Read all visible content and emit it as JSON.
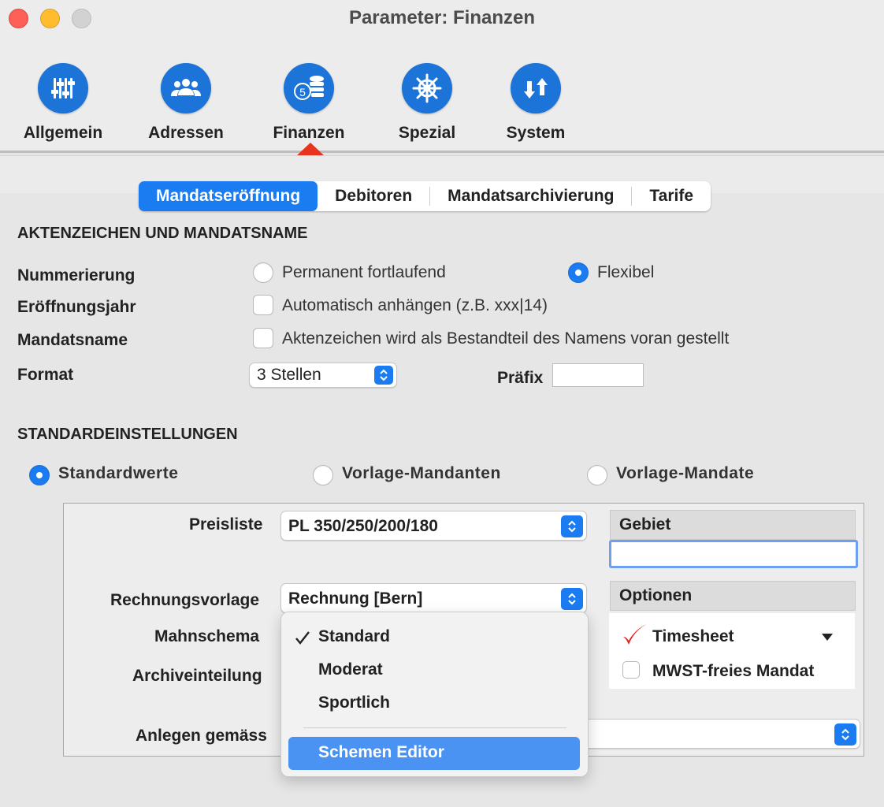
{
  "window": {
    "title": "Parameter: Finanzen"
  },
  "toolbar": {
    "items": [
      {
        "label": "Allgemein",
        "icon": "sliders-icon"
      },
      {
        "label": "Adressen",
        "icon": "people-icon"
      },
      {
        "label": "Finanzen",
        "icon": "coins-icon",
        "selected": true
      },
      {
        "label": "Spezial",
        "icon": "helm-icon"
      },
      {
        "label": "System",
        "icon": "arrows-icon"
      }
    ]
  },
  "tabs": [
    {
      "label": "Mandatseröffnung",
      "active": true
    },
    {
      "label": "Debitoren"
    },
    {
      "label": "Mandatsarchivierung"
    },
    {
      "label": "Tarife"
    }
  ],
  "aktenzeichen": {
    "title": "AKTENZEICHEN UND MANDATSNAME",
    "nummerierung_label": "Nummerierung",
    "nummerierung_opt1": "Permanent fortlaufend",
    "nummerierung_opt2": "Flexibel",
    "eroeffnungsjahr_label": "Eröffnungsjahr",
    "eroeffnungsjahr_check": "Automatisch anhängen (z.B. xxx|14)",
    "mandatsname_label": "Mandatsname",
    "mandatsname_check": "Aktenzeichen wird als Bestandteil des Namens voran gestellt",
    "format_label": "Format",
    "format_value": "3 Stellen",
    "praefix_label": "Präfix",
    "praefix_value": ""
  },
  "standard": {
    "title": "STANDARDEINSTELLUNGEN",
    "opt1": "Standardwerte",
    "opt2": "Vorlage-Mandanten",
    "opt3": "Vorlage-Mandate",
    "preisliste_label": "Preisliste",
    "preisliste_value": "PL 350/250/200/180",
    "rechnungsvorlage_label": "Rechnungsvorlage",
    "rechnungsvorlage_value": "Rechnung [Bern]",
    "mahnschema_label": "Mahnschema",
    "archiveinteilung_label": "Archiveinteilung",
    "anlegen_label": "Anlegen gemäss",
    "anlegen_value": "",
    "gebiet_header": "Gebiet",
    "gebiet_value": "",
    "optionen_header": "Optionen",
    "opt_timesheet": "Timesheet",
    "opt_mwst": "MWST-freies Mandat"
  },
  "menu": {
    "items": [
      "Standard",
      "Moderat",
      "Sportlich"
    ],
    "checked": "Standard",
    "editor": "Schemen Editor"
  },
  "colors": {
    "accent": "#1b7cf2",
    "checkmark": "#e3201b"
  }
}
